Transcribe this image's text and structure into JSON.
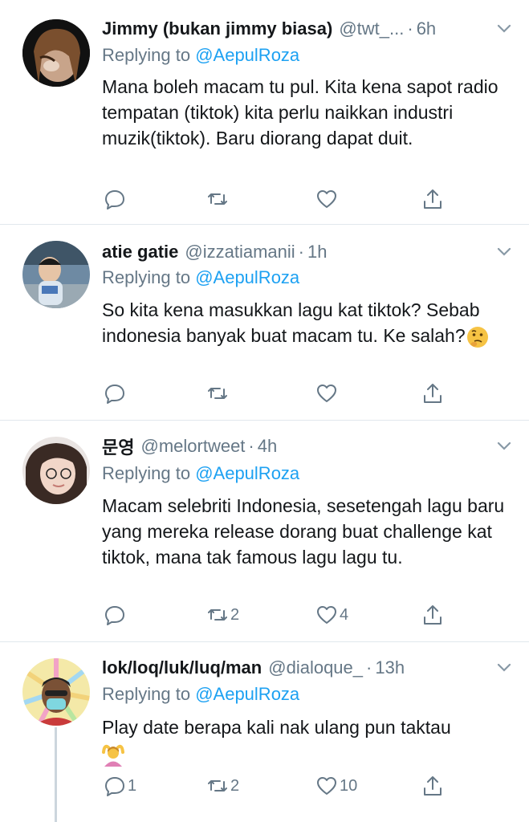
{
  "mention": "@AepulRoza",
  "replying_label": "Replying to",
  "tweets": [
    {
      "name": "Jimmy (bukan jimmy biasa)",
      "handle": "@twt_...",
      "time": "6h",
      "body": "Mana boleh macam tu pul. Kita kena sapot radio tempatan (tiktok) kita perlu naikkan industri muzik(tiktok). Baru diorang dapat duit.",
      "reply_count": "",
      "retweet_count": "",
      "like_count": ""
    },
    {
      "name": "atie gatie",
      "handle": "@izzatiamanii",
      "time": "1h",
      "body": "So kita kena masukkan lagu kat tiktok? Sebab indonesia banyak buat macam tu. Ke salah?",
      "emoji": "thinking-face",
      "reply_count": "",
      "retweet_count": "",
      "like_count": ""
    },
    {
      "name": "문영",
      "handle": "@melortweet",
      "time": "4h",
      "body": "Macam selebriti Indonesia, sesetengah lagu baru yang mereka release dorang buat challenge kat tiktok, mana tak famous lagu lagu tu.",
      "reply_count": "",
      "retweet_count": "2",
      "like_count": "4"
    },
    {
      "name": "lok/loq/luk/luq/man",
      "handle": "@dialoque_",
      "time": "13h",
      "body": "Play date berapa kali nak ulang pun taktau",
      "emoji": "woman-gesturing-ok",
      "reply_count": "1",
      "retweet_count": "2",
      "like_count": "10"
    }
  ],
  "colors": {
    "text": "#14171a",
    "muted": "#657786",
    "link": "#1da1f2",
    "divider": "#e1e8ed"
  }
}
